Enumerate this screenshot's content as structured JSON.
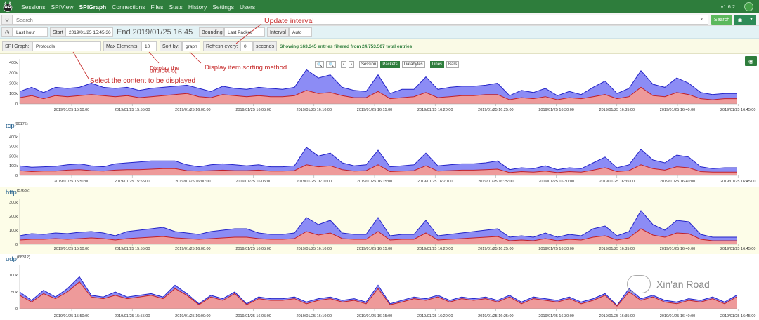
{
  "nav": {
    "items": [
      "Sessions",
      "SPIView",
      "SPIGraph",
      "Connections",
      "Files",
      "Stats",
      "History",
      "Settings",
      "Users"
    ],
    "active": "SPIGraph",
    "version": "v1.6.2"
  },
  "search": {
    "placeholder": "Search",
    "button": "Search",
    "clear": "×"
  },
  "time": {
    "range_value": "Last hour",
    "start_label": "Start",
    "start_value": "2019/01/25 15:45:36",
    "end_value": "End 2019/01/25 16:45",
    "bounding_label": "Bounding",
    "bounding_value": "Last Packet",
    "interval_label": "Interval",
    "interval_value": "Auto"
  },
  "spi": {
    "label": "SPI Graph:",
    "value": "Protocols",
    "max_label": "Max Elements:",
    "max_value": "10",
    "sort_label": "Sort by:",
    "sort_value": "graph",
    "refresh_label": "Refresh every:",
    "refresh_value": "0",
    "refresh_unit": "seconds",
    "showing": "Showing 163,345 entries filtered from 24,753,507 total entries"
  },
  "annotations": {
    "update_interval": "Update interval",
    "select_content": "Select the content to be displayed",
    "display_number_1": "Display the",
    "display_number_2": "number of",
    "sorting": "Display item sorting method"
  },
  "main_controls": {
    "zoom_out": "🔍",
    "zoom_in": "🔍",
    "prev": "‹",
    "next": "›",
    "session": "Session",
    "packets": "Packets",
    "databytes": "Databytes",
    "lines": "Lines",
    "bars": "Bars"
  },
  "sections": [
    {
      "name": "tcp",
      "count": "(90176)"
    },
    {
      "name": "http",
      "count": "(57632)"
    },
    {
      "name": "udp",
      "count": "(68312)"
    }
  ],
  "watermark": "Xin'an Road",
  "chart_data": [
    {
      "type": "area",
      "x_ticks": [
        "2019/01/25 15:50:00",
        "2019/01/25 15:55:00",
        "2019/01/25 16:00:00",
        "2019/01/25 16:05:00",
        "2019/01/25 16:10:00",
        "2019/01/25 16:15:00",
        "2019/01/25 16:20:00",
        "2019/01/25 16:25:00",
        "2019/01/25 16:30:00",
        "2019/01/25 16:35:00",
        "2019/01/25 16:40:00",
        "2019/01/25 16:45:00"
      ],
      "y_ticks": [
        "0",
        "100k",
        "200k",
        "300k",
        "400k"
      ],
      "ylim": [
        0,
        420000
      ],
      "series": [
        {
          "values": [
            120000,
            160000,
            110000,
            160000,
            150000,
            160000,
            200000,
            160000,
            150000,
            160000,
            130000,
            150000,
            160000,
            170000,
            180000,
            150000,
            120000,
            170000,
            150000,
            140000,
            160000,
            150000,
            140000,
            160000,
            330000,
            250000,
            280000,
            160000,
            130000,
            120000,
            280000,
            100000,
            140000,
            140000,
            260000,
            140000,
            160000,
            170000,
            170000,
            180000,
            200000,
            80000,
            130000,
            110000,
            150000,
            80000,
            120000,
            90000,
            160000,
            220000,
            100000,
            150000,
            320000,
            190000,
            160000,
            250000,
            200000,
            110000,
            90000,
            100000,
            100000
          ]
        },
        {
          "values": [
            60000,
            80000,
            50000,
            80000,
            70000,
            80000,
            90000,
            80000,
            70000,
            80000,
            60000,
            70000,
            80000,
            90000,
            100000,
            70000,
            60000,
            90000,
            80000,
            70000,
            80000,
            70000,
            70000,
            80000,
            130000,
            100000,
            110000,
            80000,
            60000,
            60000,
            120000,
            50000,
            60000,
            70000,
            110000,
            60000,
            70000,
            80000,
            80000,
            90000,
            90000,
            40000,
            60000,
            50000,
            70000,
            40000,
            60000,
            50000,
            70000,
            90000,
            50000,
            70000,
            160000,
            80000,
            70000,
            110000,
            90000,
            50000,
            40000,
            50000,
            50000
          ]
        }
      ]
    },
    {
      "type": "area",
      "title": "tcp",
      "y_ticks": [
        "0",
        "100k",
        "200k",
        "300k",
        "400k"
      ],
      "ylim": [
        0,
        420000
      ],
      "series": [
        {
          "values": [
            100000,
            85000,
            90000,
            95000,
            110000,
            120000,
            100000,
            90000,
            120000,
            130000,
            140000,
            150000,
            150000,
            150000,
            110000,
            90000,
            110000,
            120000,
            110000,
            100000,
            110000,
            90000,
            90000,
            100000,
            290000,
            200000,
            230000,
            130000,
            100000,
            110000,
            260000,
            90000,
            100000,
            110000,
            230000,
            100000,
            110000,
            120000,
            120000,
            130000,
            150000,
            60000,
            80000,
            70000,
            100000,
            60000,
            80000,
            70000,
            130000,
            190000,
            80000,
            110000,
            270000,
            160000,
            130000,
            210000,
            190000,
            90000,
            70000,
            80000,
            80000
          ]
        },
        {
          "values": [
            50000,
            40000,
            45000,
            45000,
            55000,
            60000,
            50000,
            45000,
            55000,
            60000,
            60000,
            65000,
            70000,
            70000,
            50000,
            45000,
            50000,
            55000,
            50000,
            50000,
            55000,
            45000,
            45000,
            50000,
            110000,
            90000,
            100000,
            60000,
            45000,
            50000,
            110000,
            40000,
            45000,
            50000,
            100000,
            45000,
            50000,
            55000,
            55000,
            60000,
            65000,
            30000,
            40000,
            35000,
            45000,
            30000,
            40000,
            35000,
            55000,
            80000,
            40000,
            50000,
            110000,
            70000,
            55000,
            90000,
            80000,
            40000,
            35000,
            35000,
            35000
          ]
        }
      ]
    },
    {
      "type": "area",
      "title": "http",
      "y_ticks": [
        "0",
        "100k",
        "200k",
        "300k"
      ],
      "ylim": [
        0,
        310000
      ],
      "series": [
        {
          "values": [
            60000,
            75000,
            70000,
            80000,
            75000,
            85000,
            90000,
            80000,
            60000,
            90000,
            100000,
            110000,
            120000,
            90000,
            80000,
            70000,
            90000,
            100000,
            110000,
            110000,
            80000,
            70000,
            70000,
            80000,
            190000,
            140000,
            170000,
            80000,
            70000,
            70000,
            190000,
            60000,
            70000,
            70000,
            170000,
            60000,
            70000,
            80000,
            90000,
            100000,
            110000,
            50000,
            60000,
            50000,
            80000,
            50000,
            70000,
            60000,
            110000,
            130000,
            60000,
            90000,
            240000,
            140000,
            100000,
            170000,
            160000,
            70000,
            50000,
            50000,
            50000
          ]
        },
        {
          "values": [
            30000,
            35000,
            35000,
            40000,
            35000,
            40000,
            45000,
            40000,
            30000,
            40000,
            45000,
            50000,
            55000,
            45000,
            40000,
            35000,
            40000,
            45000,
            50000,
            50000,
            40000,
            35000,
            35000,
            40000,
            90000,
            65000,
            80000,
            40000,
            35000,
            35000,
            90000,
            30000,
            35000,
            35000,
            80000,
            30000,
            35000,
            40000,
            45000,
            50000,
            55000,
            25000,
            30000,
            25000,
            40000,
            25000,
            35000,
            30000,
            50000,
            60000,
            30000,
            45000,
            110000,
            65000,
            50000,
            80000,
            75000,
            35000,
            25000,
            25000,
            25000
          ]
        }
      ]
    },
    {
      "type": "area",
      "title": "udp",
      "y_ticks": [
        "0",
        "50k",
        "100k"
      ],
      "ylim": [
        0,
        125000
      ],
      "series": [
        {
          "values": [
            50000,
            25000,
            55000,
            35000,
            60000,
            95000,
            40000,
            35000,
            50000,
            35000,
            40000,
            45000,
            35000,
            70000,
            45000,
            15000,
            40000,
            30000,
            50000,
            15000,
            35000,
            30000,
            30000,
            35000,
            20000,
            30000,
            35000,
            25000,
            30000,
            20000,
            70000,
            15000,
            25000,
            35000,
            30000,
            40000,
            25000,
            35000,
            30000,
            35000,
            25000,
            40000,
            20000,
            35000,
            30000,
            25000,
            35000,
            20000,
            30000,
            45000,
            10000,
            60000,
            30000,
            40000,
            25000,
            20000,
            30000,
            25000,
            35000,
            20000,
            40000
          ]
        },
        {
          "values": [
            40000,
            20000,
            45000,
            30000,
            50000,
            80000,
            35000,
            30000,
            40000,
            30000,
            35000,
            40000,
            30000,
            60000,
            40000,
            12000,
            35000,
            25000,
            45000,
            12000,
            30000,
            25000,
            25000,
            30000,
            15000,
            25000,
            30000,
            20000,
            25000,
            15000,
            60000,
            12000,
            20000,
            30000,
            25000,
            35000,
            20000,
            30000,
            25000,
            30000,
            20000,
            35000,
            15000,
            30000,
            25000,
            20000,
            30000,
            15000,
            25000,
            40000,
            8000,
            50000,
            25000,
            35000,
            20000,
            15000,
            25000,
            20000,
            30000,
            15000,
            35000
          ]
        }
      ]
    }
  ]
}
